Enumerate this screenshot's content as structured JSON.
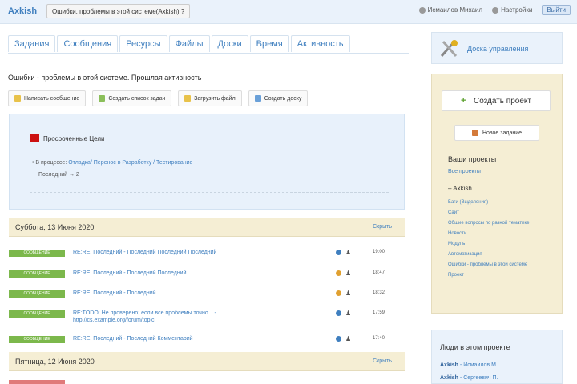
{
  "header": {
    "logo": "Axkish",
    "breadcrumb": "Ошибки, проблемы в этой системе(Axkish) ?",
    "user": "Исмаилов Михаил",
    "settings": "Настройки",
    "exit": "Выйти"
  },
  "tabs": [
    "Задания",
    "Сообщения",
    "Ресурсы",
    "Файлы",
    "Доски",
    "Время",
    "Активность"
  ],
  "project_title": "Ошибки - проблемы в этой системе. Прошлая активность",
  "actions": [
    "Написать сообщение",
    "Создать список задач",
    "Загрузить файл",
    "Создать доску"
  ],
  "activity": {
    "heading": "Просроченные Цели",
    "line1_prefix": "В процессе:",
    "line1_link": "Отладка/ Перенос в Разработку / Тестирование",
    "line2": "Последний → 2"
  },
  "days": [
    {
      "date": "Суббота, 13 Июня 2020",
      "hide": "Скрыть",
      "rows": [
        {
          "badge": "СООБЩЕНИЕ",
          "text": "RE:RE: Последний - Последний Последний Последний",
          "time": "19:00"
        },
        {
          "badge": "СООБЩЕНИЕ",
          "text": "RE:RE: Последний - Последний Последний",
          "time": "18:47"
        },
        {
          "badge": "СООБЩЕНИЕ",
          "text": "RE:RE: Последний - Последний",
          "time": "18:32"
        },
        {
          "badge": "СООБЩЕНИЕ",
          "text": "RE:TODO: Не проверено; если все проблемы точно... - http://cs.example.org/forum/topic",
          "time": "17:59"
        },
        {
          "badge": "СООБЩЕНИЕ",
          "text": "RE:RE: Последний - Последний Комментарий",
          "time": "17:40"
        }
      ]
    },
    {
      "date": "Пятница, 12 Июня 2020",
      "hide": "Скрыть",
      "rows": []
    }
  ],
  "sidebar": {
    "dashboard": "Доска управления",
    "create_project": "Создать проект",
    "new_task": "Новое задание",
    "projects_title": "Ваши проекты",
    "all_projects": "Все проекты",
    "group": "Axkish",
    "projects": [
      "Баги (Выделения)",
      "Сайт",
      "Общие вопросы по разной тематике",
      "Новости",
      "Модуль",
      "Автоматизация",
      "Ошибки - проблемы в этой системе",
      "Проект"
    ]
  },
  "people": {
    "title": "Люди в этом проекте",
    "person1_company": "Axkish",
    "person1_name": "Исмаилов М.",
    "person2_company": "Axkish",
    "person2_name": "Сергеевич П."
  }
}
